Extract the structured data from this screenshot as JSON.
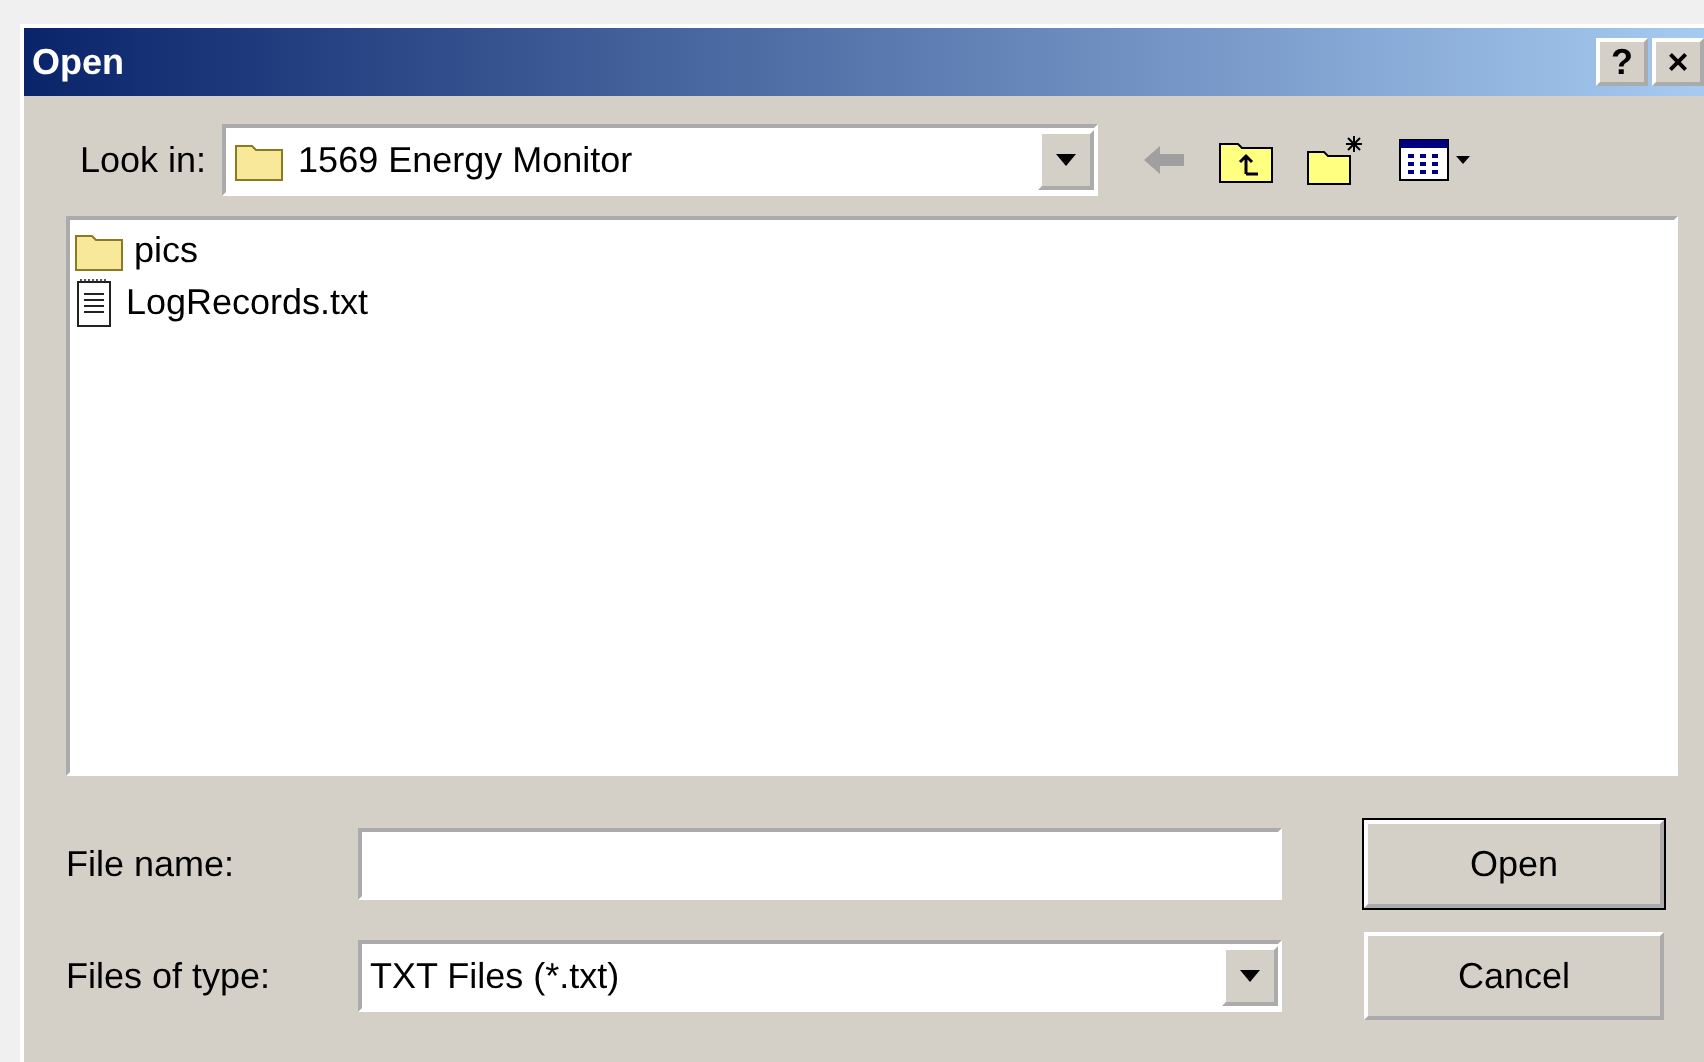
{
  "window": {
    "title": "Open",
    "title_buttons": [
      "?",
      "×"
    ]
  },
  "look_in": {
    "label": "Look in:",
    "value": "1569 Energy Monitor"
  },
  "files": [
    {
      "kind": "folder",
      "name": "pics",
      "selected": false
    },
    {
      "kind": "text",
      "name": "LogRecords.txt",
      "selected": false
    }
  ],
  "file_name": {
    "label": "File name:"
  },
  "file_type": {
    "label": "Files of type:",
    "value": "TXT Files (*.txt)"
  },
  "buttons": [
    {
      "label": "Open",
      "default": true
    },
    {
      "label": "Cancel",
      "default": false
    }
  ]
}
